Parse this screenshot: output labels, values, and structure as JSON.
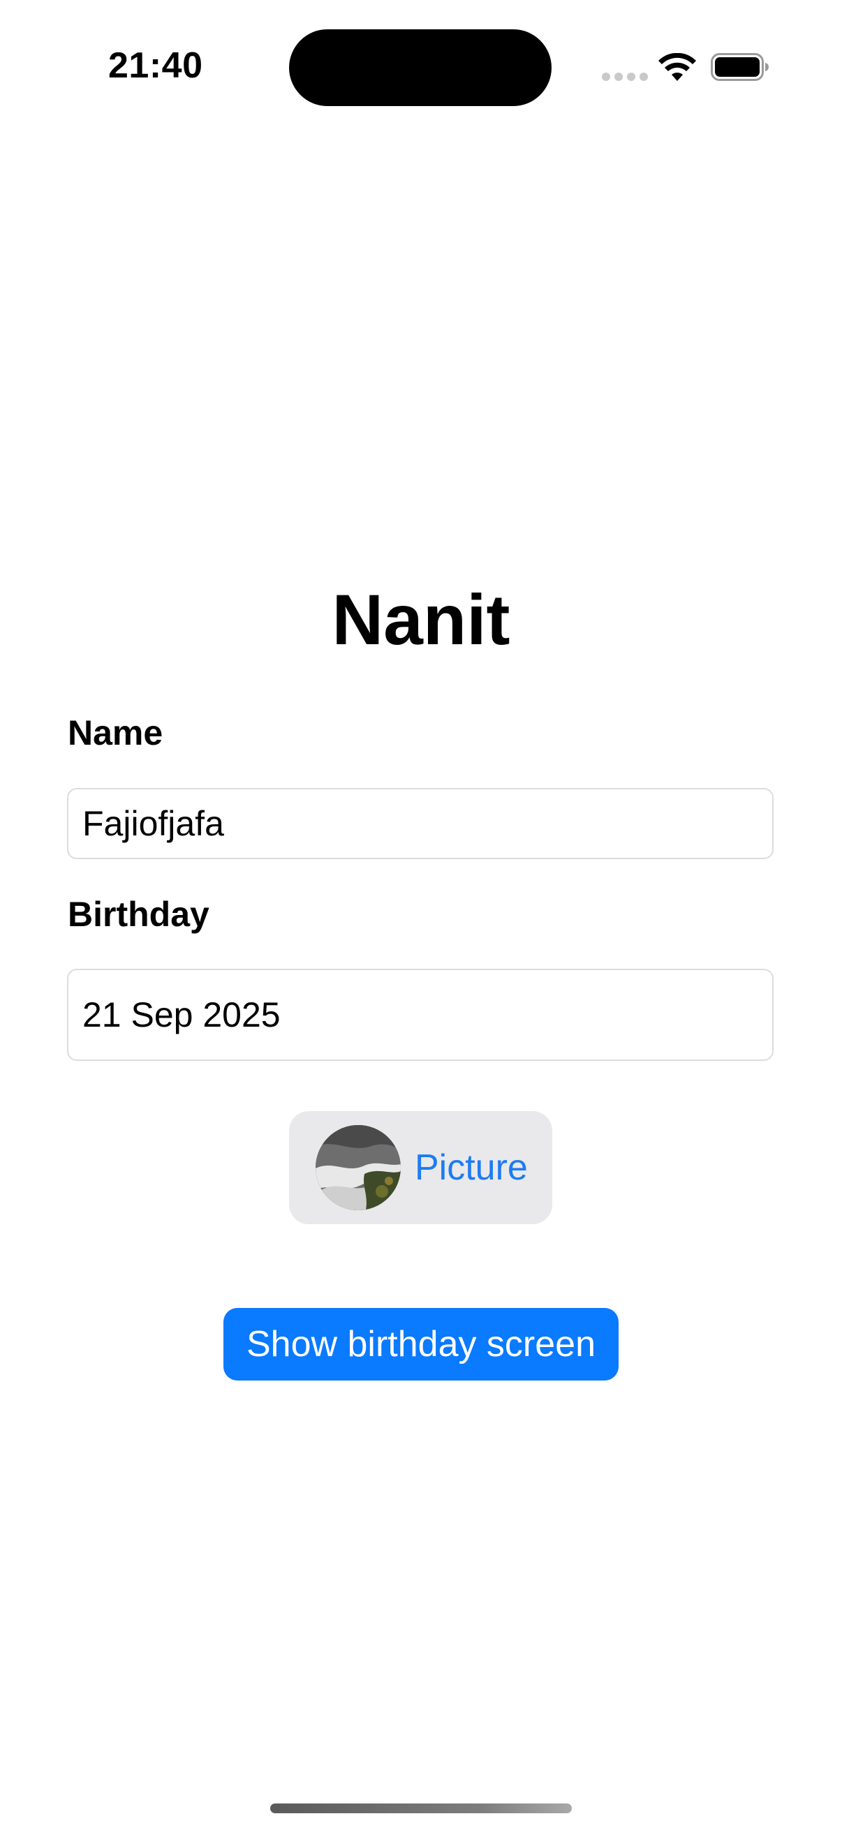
{
  "status_bar": {
    "time": "21:40"
  },
  "screen": {
    "title": "Nanit",
    "name_label": "Name",
    "name_value": "Fajiofjafa",
    "birthday_label": "Birthday",
    "birthday_value": "21 Sep 2025",
    "picture_button_label": "Picture",
    "show_birthday_button_label": "Show birthday screen"
  },
  "icons": {
    "cellular": "signal-dots-icon",
    "wifi": "wifi-icon",
    "battery": "battery-icon",
    "picture": "photo-thumbnail"
  },
  "colors": {
    "accent": "#0a7aff",
    "link": "#1d7cf2",
    "picture_button_bg": "#e9e9eb",
    "field_border": "#dcdcde"
  }
}
